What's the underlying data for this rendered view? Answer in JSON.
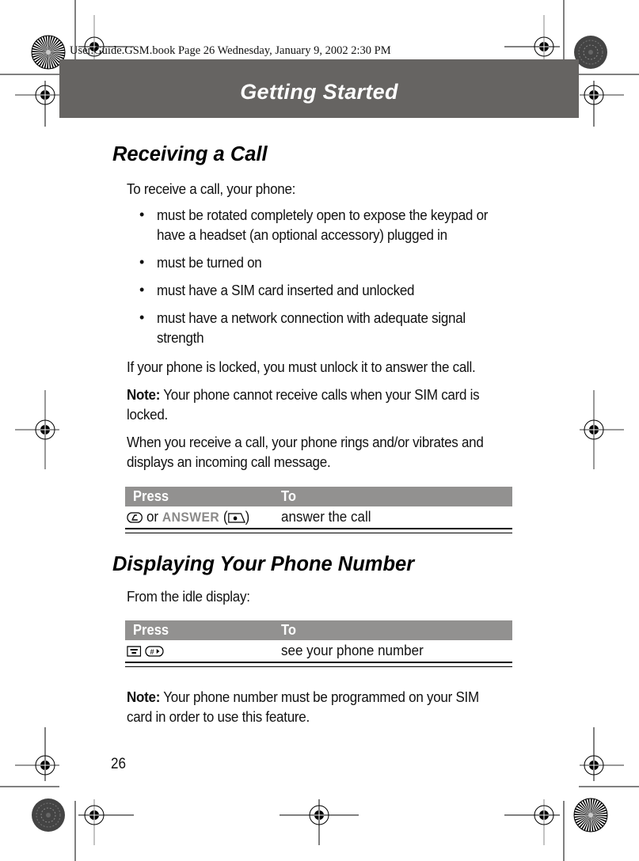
{
  "print_slug": "User.Guide.GSM.book  Page 26  Wednesday, January 9, 2002  2:30 PM",
  "banner": {
    "title": "Getting Started"
  },
  "section1": {
    "heading": "Receiving a Call",
    "intro": "To receive a call, your phone:",
    "bullets": [
      {
        "line1": "must be rotated completely open to expose the keypad or",
        "line2": "have a headset (an optional accessory) plugged in"
      },
      {
        "line1": "must be turned on"
      },
      {
        "line1": "must have a SIM card inserted and unlocked"
      },
      {
        "line1": "must have a network connection with adequate signal",
        "line2": "strength"
      }
    ],
    "locked_text": "If your phone is locked, you must unlock it to answer the call.",
    "note": {
      "label": "Note:",
      "line1": " Your phone cannot receive calls when your SIM card is",
      "line2": "locked."
    },
    "receive_text": {
      "line1": "When you receive a call, your phone rings and/or vibrates and",
      "line2": "displays an incoming call message."
    },
    "table": {
      "headers": [
        "Press",
        "To"
      ],
      "rows": [
        {
          "press_keys": [
            "send-key-icon"
          ],
          "press_or": "or",
          "press_softkey": "ANSWER",
          "press_softkey_icon": "left-soft-key-icon",
          "to": "answer the call"
        }
      ]
    }
  },
  "section2": {
    "heading": "Displaying Your Phone Number",
    "intro": "From the idle display:",
    "table": {
      "headers": [
        "Press",
        "To"
      ],
      "rows": [
        {
          "press_keys": [
            "menu-key-icon",
            "pound-key-icon"
          ],
          "to": "see your phone number"
        }
      ]
    },
    "note": {
      "label": "Note:",
      "line1": " Your phone number must be programmed on your SIM",
      "line2": "card in order to use this feature."
    }
  },
  "page_number": "26"
}
